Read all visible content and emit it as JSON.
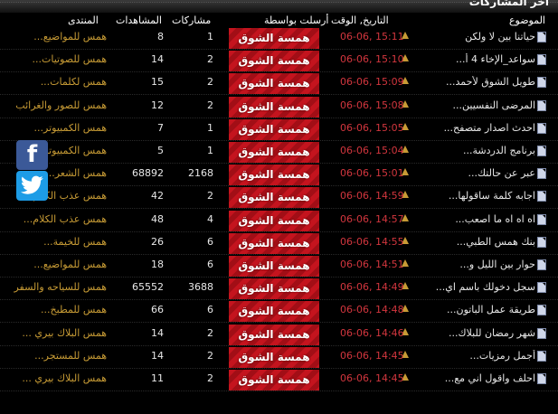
{
  "section_title": "اخر المشاركات",
  "headers": {
    "topic": "الموضوع",
    "datetime": "التاريخ, الوقت",
    "poster": "أرسلت بواسطة",
    "posts": "مشاركات",
    "views": "المشاهدات",
    "forum": "المنتدى"
  },
  "colors": {
    "poster_bg": "#c4141e",
    "forum_link": "#c79b35",
    "time": "#d3363e"
  },
  "rows": [
    {
      "topic": "حياتنا بين لا ولكن",
      "time": "06-06, 15:11",
      "poster": "همسة الشوق",
      "posts": "1",
      "views": "8",
      "forum": "همس للمواضيع..."
    },
    {
      "topic": "سواعد_الإخاء 4 أ...",
      "time": "06-06, 15:10",
      "poster": "همسة الشوق",
      "posts": "2",
      "views": "14",
      "forum": "همس للصوتيات..."
    },
    {
      "topic": "طويل الشوق لأحمد...",
      "time": "06-06, 15:09",
      "poster": "همسة الشوق",
      "posts": "2",
      "views": "15",
      "forum": "همس لكلمات..."
    },
    {
      "topic": "المرضى النفسيين...",
      "time": "06-06, 15:08",
      "poster": "همسة الشوق",
      "posts": "2",
      "views": "12",
      "forum": "همس للصور والغرائب"
    },
    {
      "topic": "احدث اصدار متصفح...",
      "time": "06-06, 15:05",
      "poster": "همسة الشوق",
      "posts": "1",
      "views": "7",
      "forum": "همس الكمبيوتر..."
    },
    {
      "topic": "برنامج الدردشة...",
      "time": "06-06, 15:04",
      "poster": "همسة الشوق",
      "posts": "1",
      "views": "5",
      "forum": "همس الكمبيوتر..."
    },
    {
      "topic": "عبر عن حالتك...",
      "time": "06-06, 15:01",
      "poster": "همسة الشوق",
      "posts": "2168",
      "views": "68892",
      "forum": "همس الشعر..."
    },
    {
      "topic": "اجابه كلمة ساقولها...",
      "time": "06-06, 14:59",
      "poster": "همسة الشوق",
      "posts": "2",
      "views": "42",
      "forum": "همس عذب الكلام..."
    },
    {
      "topic": "اه اه اه ما اصعب...",
      "time": "06-06, 14:57",
      "poster": "همسة الشوق",
      "posts": "4",
      "views": "48",
      "forum": "همس عذب الكلام..."
    },
    {
      "topic": "بنك همس الطبي...",
      "time": "06-06, 14:55",
      "poster": "همسة الشوق",
      "posts": "6",
      "views": "26",
      "forum": "همس للخيمة..."
    },
    {
      "topic": "حوار بين الليل و...",
      "time": "06-06, 14:51",
      "poster": "همسة الشوق",
      "posts": "6",
      "views": "18",
      "forum": "همس للمواضيع..."
    },
    {
      "topic": "سجل دخولك باسم اي...",
      "time": "06-06, 14:49",
      "poster": "همسة الشوق",
      "posts": "3688",
      "views": "65552",
      "forum": "همس للسياحه والسفر"
    },
    {
      "topic": "طريقة عمل الباتون...",
      "time": "06-06, 14:48",
      "poster": "همسة الشوق",
      "posts": "6",
      "views": "66",
      "forum": "همس للمطبخ..."
    },
    {
      "topic": "شهر رمضان للبلاك...",
      "time": "06-06, 14:46",
      "poster": "همسة الشوق",
      "posts": "2",
      "views": "14",
      "forum": "همس البلاك بيري ..."
    },
    {
      "topic": "أجمل رمزيات...",
      "time": "06-06, 14:45",
      "poster": "همسة الشوق",
      "posts": "2",
      "views": "14",
      "forum": "همس للمستجر..."
    },
    {
      "topic": "احلف واقول اني مع...",
      "time": "06-06, 14:45",
      "poster": "همسة الشوق",
      "posts": "2",
      "views": "11",
      "forum": "همس البلاك بيري ..."
    }
  ],
  "social": {
    "facebook_glyph": "f"
  }
}
